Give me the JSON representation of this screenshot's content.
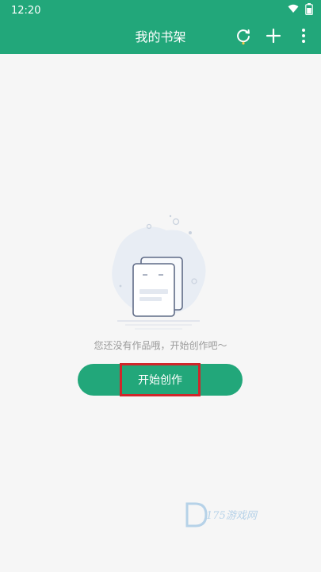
{
  "status": {
    "time": "12:20"
  },
  "appbar": {
    "title": "我的书架"
  },
  "icons": {
    "sync": "sync-icon",
    "add": "plus-icon",
    "more": "more-vertical-icon",
    "wifi": "wifi-icon",
    "battery": "battery-icon"
  },
  "empty_state": {
    "message": "您还没有作品哦，开始创作吧～",
    "button_label": "开始创作"
  },
  "watermark": {
    "text": "175游戏网"
  },
  "colors": {
    "primary": "#22a77a",
    "highlight": "#d0262b",
    "text_muted": "#9a9a9a",
    "background": "#f6f6f6"
  }
}
